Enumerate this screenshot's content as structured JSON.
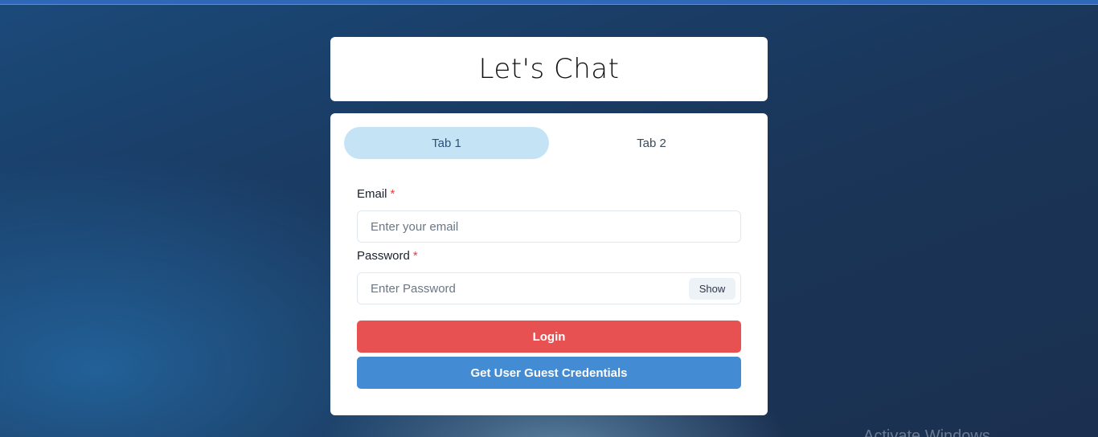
{
  "header": {
    "title": "Let's Chat"
  },
  "tabs": [
    {
      "label": "Tab 1",
      "active": true
    },
    {
      "label": "Tab 2",
      "active": false
    }
  ],
  "form": {
    "email": {
      "label": "Email",
      "required_mark": "*",
      "placeholder": "Enter your email",
      "value": ""
    },
    "password": {
      "label": "Password",
      "required_mark": "*",
      "placeholder": "Enter Password",
      "value": "",
      "toggle_label": "Show"
    },
    "login_label": "Login",
    "guest_label": "Get User Guest Credentials"
  },
  "watermark": {
    "text": "Activate Windows"
  },
  "colors": {
    "login_button": "#e85151",
    "guest_button": "#438bd3",
    "active_tab": "#c4e4f6",
    "required": "#e53e3e"
  }
}
